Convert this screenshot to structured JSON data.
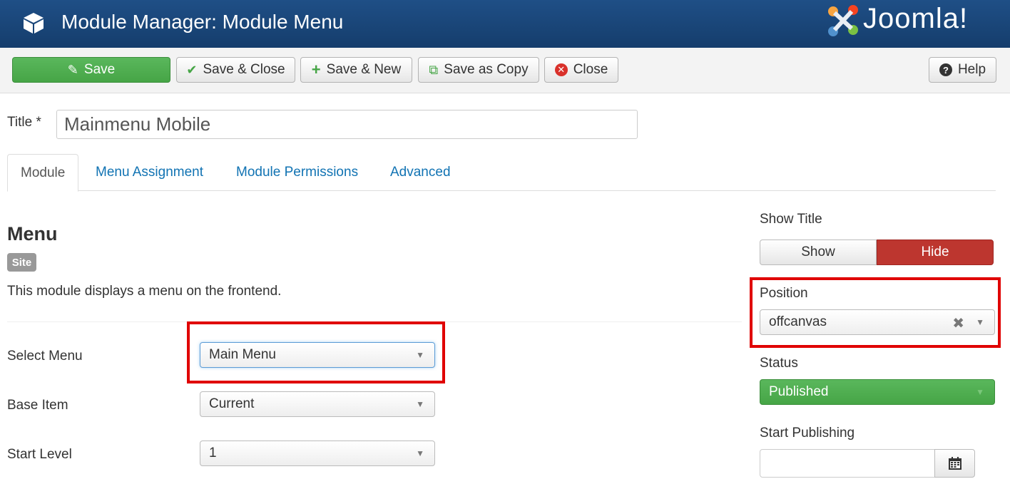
{
  "header": {
    "title": "Module Manager: Module Menu",
    "logo_text": "Joomla!",
    "cube_icon": "cube-icon"
  },
  "toolbar": {
    "save": "Save",
    "save_close": "Save & Close",
    "save_new": "Save & New",
    "save_copy": "Save as Copy",
    "close": "Close",
    "help": "Help"
  },
  "title_field": {
    "label": "Title *",
    "value": "Mainmenu Mobile"
  },
  "tabs": [
    {
      "label": "Module",
      "active": true
    },
    {
      "label": "Menu Assignment",
      "active": false
    },
    {
      "label": "Module Permissions",
      "active": false
    },
    {
      "label": "Advanced",
      "active": false
    }
  ],
  "module": {
    "heading": "Menu",
    "badge": "Site",
    "description": "This module displays a menu on the frontend."
  },
  "fields": {
    "select_menu": {
      "label": "Select Menu",
      "value": "Main Menu"
    },
    "base_item": {
      "label": "Base Item",
      "value": "Current"
    },
    "start_level": {
      "label": "Start Level",
      "value": "1"
    }
  },
  "sidebar": {
    "show_title": {
      "label": "Show Title",
      "show": "Show",
      "hide": "Hide",
      "selected": "Hide"
    },
    "position": {
      "label": "Position",
      "value": "offcanvas"
    },
    "status": {
      "label": "Status",
      "value": "Published"
    },
    "start_publishing": {
      "label": "Start Publishing",
      "value": ""
    }
  },
  "colors": {
    "header_bg": "#1a4a80",
    "save_green": "#46a546",
    "hide_red": "#bd362f",
    "link_blue": "#1173b3",
    "highlight_red": "#e00000"
  }
}
